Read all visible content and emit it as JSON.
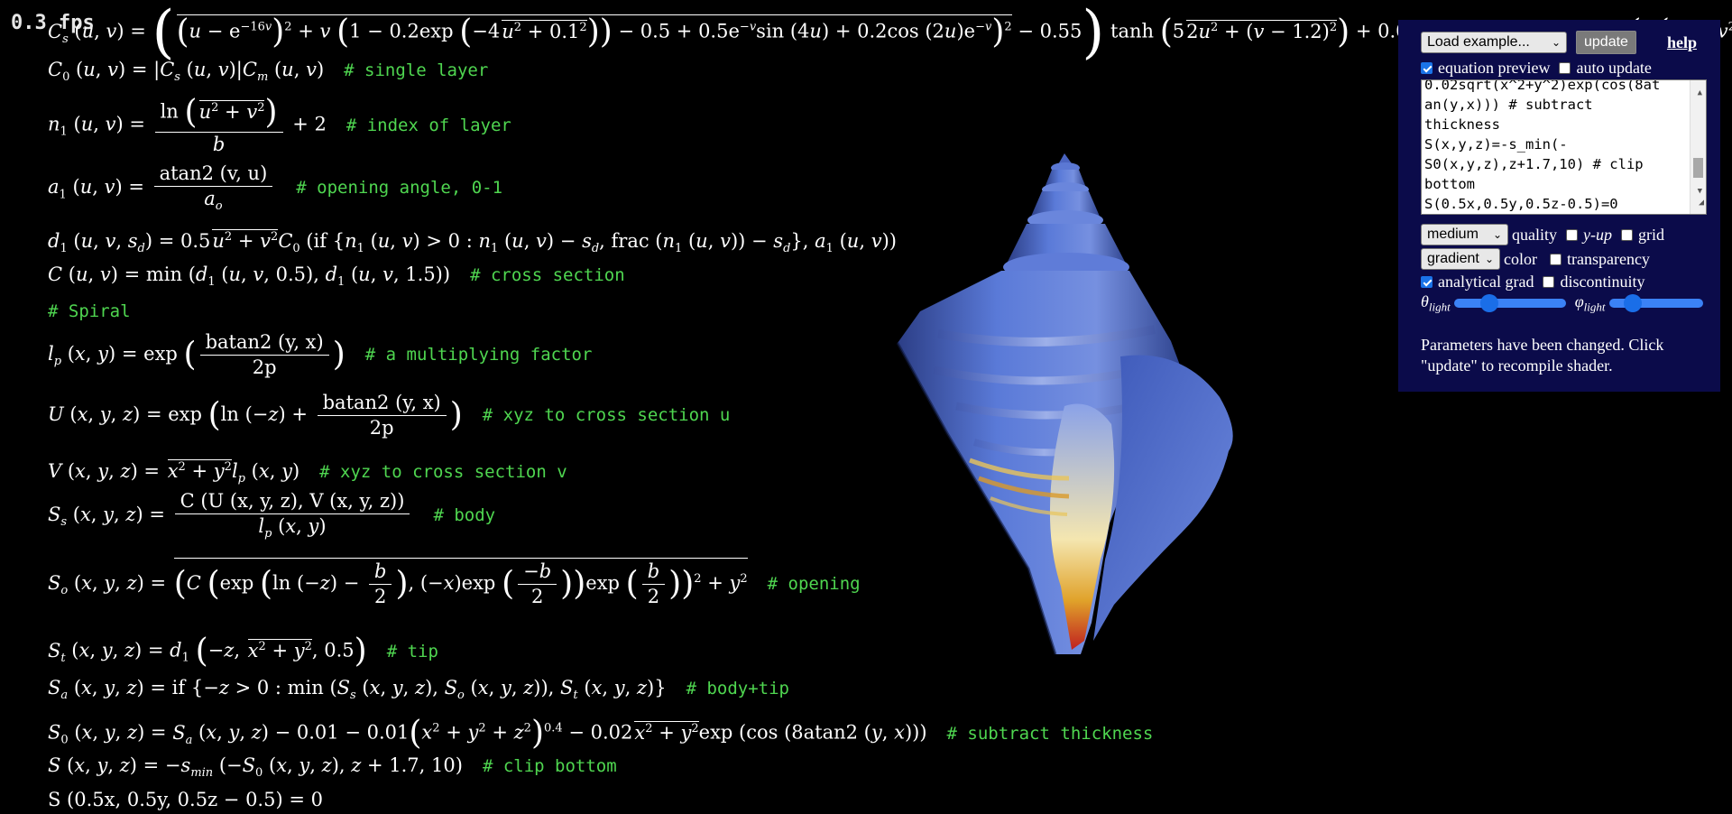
{
  "fps": "0.3 fps",
  "equations": {
    "cs_lhs": "C",
    "c0": {
      "lhs": "C",
      "rhs": "|C",
      "comment": "# single layer"
    },
    "n1": {
      "comment": "# index of layer"
    },
    "a1": {
      "num": "atan2 (v, u)",
      "comment": "# opening angle, 0-1"
    },
    "d1": {
      "comment": ""
    },
    "C": {
      "comment": "# cross section"
    },
    "spiral": "# Spiral",
    "lp": {
      "num": "batan2 (y, x)",
      "den": "2p",
      "comment": "# a multiplying factor"
    },
    "U": {
      "num": "batan2 (y, x)",
      "den": "2p",
      "comment": "# xyz to cross section u"
    },
    "V": {
      "comment": "# xyz to cross section v"
    },
    "Ss": {
      "num": "C (U (x, y, z), V (x, y, z))",
      "comment": "# body"
    },
    "So": {
      "comment": "# opening"
    },
    "St": {
      "comment": "# tip"
    },
    "Sa": {
      "comment": "# body+tip"
    },
    "S0": {
      "comment": "# subtract thickness"
    },
    "S": {
      "comment": "# clip bottom"
    },
    "final": "S (0.5x, 0.5y, 0.5z − 0.5) = 0"
  },
  "panel": {
    "load_example": "Load example...",
    "update": "update",
    "help": "help",
    "equation_preview": "equation preview",
    "auto_update": "auto update",
    "editor_lines": [
      "0.02sqrt(x^2+y^2)exp(cos(8at",
      "an(y,x))) # subtract",
      "thickness",
      "S(x,y,z)=-s_min(-",
      "S0(x,y,z),z+1.7,10) # clip",
      "bottom",
      "S(0.5x,0.5y,0.5z-0.5)=0"
    ],
    "quality_value": "medium",
    "quality_label": "quality",
    "y_up": "y-up",
    "grid": "grid",
    "color_value": "gradient",
    "color_label": "color",
    "transparency": "transparency",
    "analytical_grad": "analytical grad",
    "discontinuity": "discontinuity",
    "theta_label": "θ",
    "phi_label": "φ",
    "light_sub": "light",
    "message": "Parameters have been changed. Click \"update\" to recompile shader.",
    "equation_preview_checked": true,
    "auto_update_checked": false,
    "y_up_checked": false,
    "grid_checked": false,
    "transparency_checked": false,
    "analytical_grad_checked": true,
    "discontinuity_checked": false,
    "theta_level": 0.28,
    "phi_level": 0.2
  },
  "colors": {
    "comment_green": "#4fd650",
    "panel_bg": "#0b0b4a",
    "shell_blue": "#4d6fcf"
  }
}
